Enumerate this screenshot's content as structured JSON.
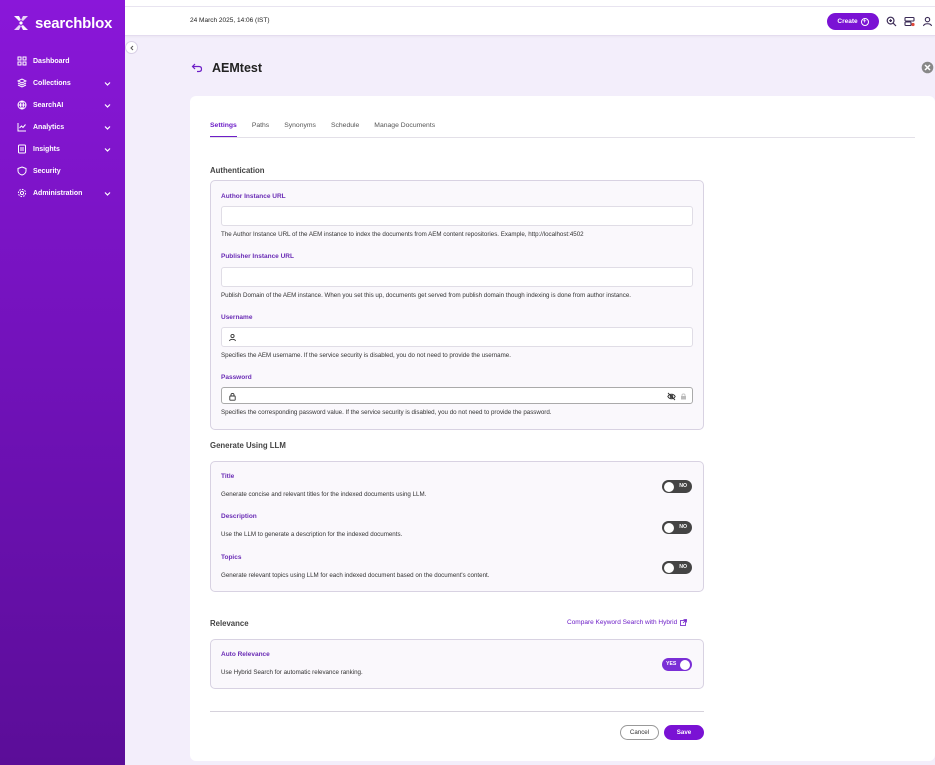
{
  "app": {
    "brand": "searchblox",
    "datetime": "24 March 2025, 14:06 (IST)",
    "create_label": "Create",
    "accent": "#7a12d4"
  },
  "sidebar": {
    "items": [
      {
        "label": "Dashboard",
        "icon": "dashboard-icon",
        "chevron": false
      },
      {
        "label": "Collections",
        "icon": "collections-icon",
        "chevron": true
      },
      {
        "label": "SearchAI",
        "icon": "searchai-icon",
        "chevron": true
      },
      {
        "label": "Analytics",
        "icon": "analytics-icon",
        "chevron": true
      },
      {
        "label": "Insights",
        "icon": "insights-icon",
        "chevron": true
      },
      {
        "label": "Security",
        "icon": "shield-icon",
        "chevron": false
      },
      {
        "label": "Administration",
        "icon": "gear-icon",
        "chevron": true
      }
    ]
  },
  "page": {
    "title": "AEMtest",
    "tabs": [
      "Settings",
      "Paths",
      "Synonyms",
      "Schedule",
      "Manage Documents"
    ],
    "active_tab": "Settings"
  },
  "authentication": {
    "title": "Authentication",
    "author_url": {
      "label": "Author Instance URL",
      "value": "",
      "help": "The Author Instance URL of the AEM instance to index the documents from AEM content repositories. Example, http://localhost:4502"
    },
    "publisher_url": {
      "label": "Publisher Instance URL",
      "value": "",
      "help": "Publish Domain of the AEM instance. When you set this up, documents get served from publish domain though indexing is done from author instance."
    },
    "username": {
      "label": "Username",
      "value": "",
      "help": "Specifies the AEM username. If the service security is disabled, you do not need to provide the username."
    },
    "password": {
      "label": "Password",
      "value": "",
      "help": "Specifies the corresponding password value. If the service security is disabled, you do not need to provide the password."
    }
  },
  "llm": {
    "title": "Generate Using LLM",
    "items": [
      {
        "label": "Title",
        "help": "Generate concise and relevant titles for the indexed documents using LLM.",
        "state": "NO"
      },
      {
        "label": "Description",
        "help": "Use the LLM to generate a description for the indexed documents.",
        "state": "NO"
      },
      {
        "label": "Topics",
        "help": "Generate relevant topics using LLM for each indexed document based on the document's content.",
        "state": "NO"
      }
    ]
  },
  "relevance": {
    "title": "Relevance",
    "compare_link": "Compare Keyword Search with Hybrid",
    "auto": {
      "label": "Auto Relevance",
      "help": "Use Hybrid Search for automatic relevance ranking.",
      "state": "YES"
    }
  },
  "footer": {
    "cancel": "Cancel",
    "save": "Save"
  }
}
